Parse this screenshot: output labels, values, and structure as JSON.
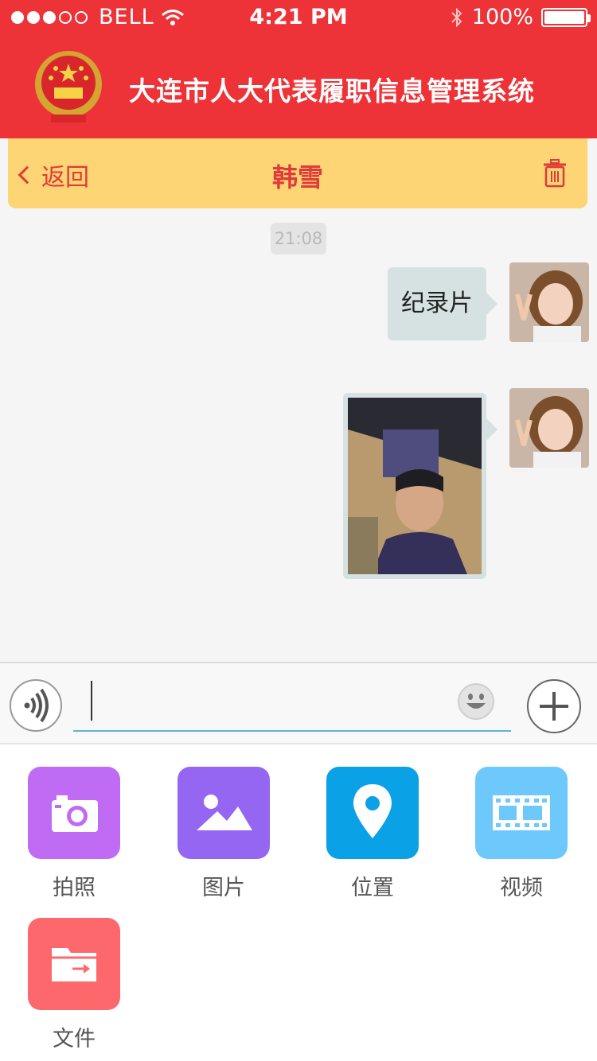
{
  "status_bar": {
    "carrier": "BELL",
    "time": "4:21 PM",
    "battery": "100%"
  },
  "header": {
    "title": "大连市人大代表履职信息管理系统"
  },
  "nav": {
    "back_label": "返回",
    "title": "韩雪"
  },
  "chat": {
    "timestamp": "21:08",
    "messages": [
      {
        "type": "text",
        "text": "纪录片"
      },
      {
        "type": "image"
      }
    ]
  },
  "input": {
    "placeholder": ""
  },
  "tools": [
    {
      "label": "拍照",
      "icon": "camera-icon",
      "color": "#bf6bf3"
    },
    {
      "label": "图片",
      "icon": "image-icon",
      "color": "#9566f2"
    },
    {
      "label": "位置",
      "icon": "location-pin-icon",
      "color": "#0aa1e7"
    },
    {
      "label": "视频",
      "icon": "film-icon",
      "color": "#6dc8fb"
    },
    {
      "label": "文件",
      "icon": "folder-icon",
      "color": "#fd686c"
    }
  ],
  "colors": {
    "header_red": "#ee3338",
    "nav_yellow": "#fdd574",
    "accent_red": "#e03a3a",
    "bubble": "#d6e2e2",
    "input_underline": "#5fb6d3"
  }
}
